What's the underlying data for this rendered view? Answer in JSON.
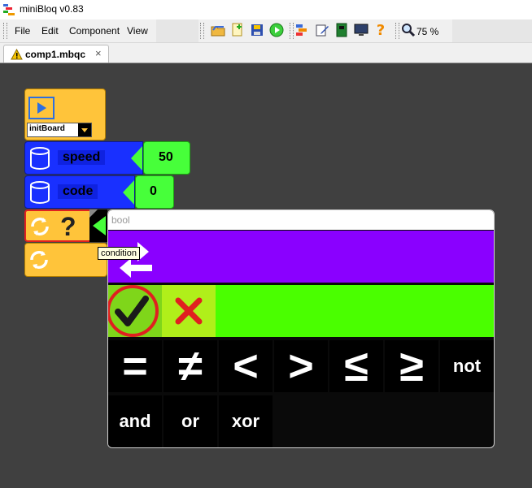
{
  "window": {
    "title": "miniBloq v0.83"
  },
  "menu": [
    "File",
    "Edit",
    "Component",
    "View"
  ],
  "toolbar": {
    "icons": [
      "folder-open-icon",
      "new-file-icon",
      "save-icon",
      "run-icon",
      "blocks-icon",
      "edit-icon",
      "board-icon",
      "monitor-icon",
      "help-icon"
    ],
    "zoom": "75 %"
  },
  "tab": {
    "title": "comp1.mbqc",
    "close": "×",
    "warning_icon": "warning-icon"
  },
  "blocks": {
    "init_value": "initBoard",
    "var1": {
      "name": "speed",
      "value": "50"
    },
    "var2": {
      "name": "code",
      "value": "0"
    },
    "if_symbol": "?"
  },
  "tooltip": "condition",
  "popup": {
    "title": "bool",
    "operators": [
      "=",
      "≠",
      "<",
      ">",
      "≤",
      "≥",
      "not"
    ],
    "logic": [
      "and",
      "or",
      "xor"
    ]
  },
  "colors": {
    "canvas": "#404040",
    "block_orange": "#ffc43a",
    "block_blue": "#1930ff",
    "block_green": "#47ff3a",
    "popup_purple": "#8a00ff",
    "popup_green": "#4aff00"
  }
}
